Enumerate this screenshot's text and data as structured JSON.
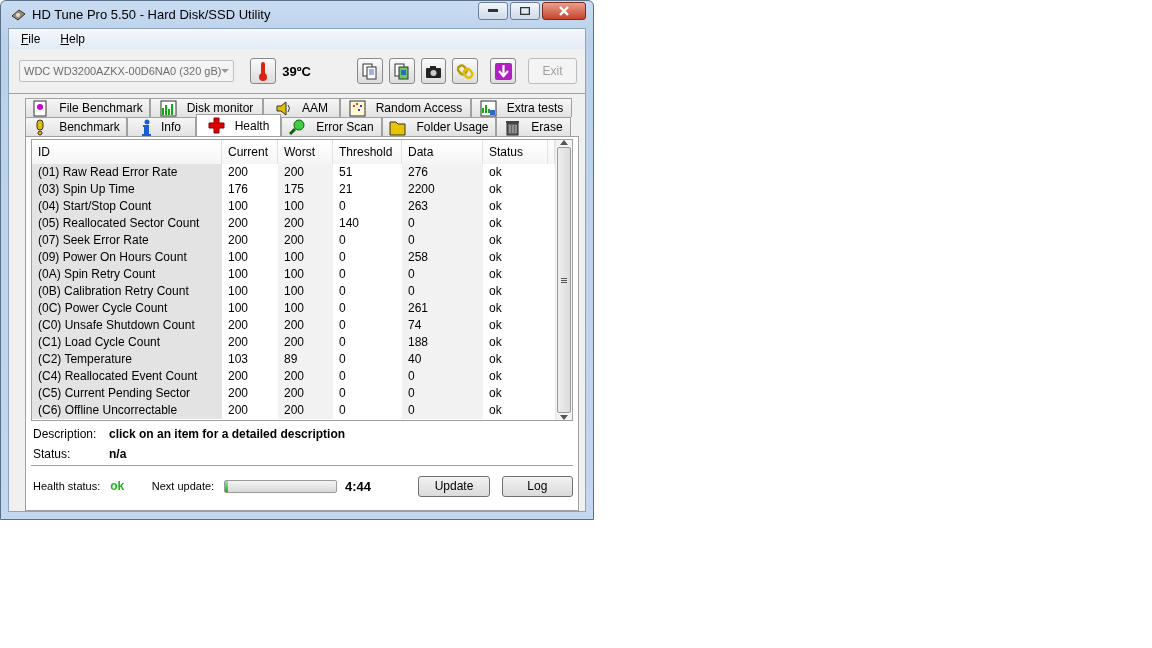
{
  "window": {
    "title": "HD Tune Pro 5.50 - Hard Disk/SSD Utility"
  },
  "menu": [
    "File",
    "Help"
  ],
  "toolbar": {
    "drive": "WDC WD3200AZKX-00D6NA0 (320 gB)",
    "temperature": "39ºC",
    "exit": {
      "label": "Exit",
      "disabled": true
    }
  },
  "tabs": [
    [
      {
        "label": "File Benchmark",
        "selected": false
      },
      {
        "label": "Disk monitor",
        "selected": false
      },
      {
        "label": "AAM",
        "selected": false
      },
      {
        "label": "Random Access",
        "selected": false
      },
      {
        "label": "Extra tests",
        "selected": false
      }
    ],
    [
      {
        "label": "Benchmark",
        "selected": false
      },
      {
        "label": "Info",
        "selected": false
      },
      {
        "label": "Health",
        "selected": true
      },
      {
        "label": "Error Scan",
        "selected": false
      },
      {
        "label": "Folder Usage",
        "selected": false
      },
      {
        "label": "Erase",
        "selected": false
      }
    ]
  ],
  "table": {
    "columns": [
      "ID",
      "Current",
      "Worst",
      "Threshold",
      "Data",
      "Status"
    ],
    "rows": [
      [
        "(01) Raw Read Error Rate",
        "200",
        "200",
        "51",
        "276",
        "ok"
      ],
      [
        "(03) Spin Up Time",
        "176",
        "175",
        "21",
        "2200",
        "ok"
      ],
      [
        "(04) Start/Stop Count",
        "100",
        "100",
        "0",
        "263",
        "ok"
      ],
      [
        "(05) Reallocated Sector Count",
        "200",
        "200",
        "140",
        "0",
        "ok"
      ],
      [
        "(07) Seek Error Rate",
        "200",
        "200",
        "0",
        "0",
        "ok"
      ],
      [
        "(09) Power On Hours Count",
        "100",
        "100",
        "0",
        "258",
        "ok"
      ],
      [
        "(0A) Spin Retry Count",
        "100",
        "100",
        "0",
        "0",
        "ok"
      ],
      [
        "(0B) Calibration Retry Count",
        "100",
        "100",
        "0",
        "0",
        "ok"
      ],
      [
        "(0C) Power Cycle Count",
        "100",
        "100",
        "0",
        "261",
        "ok"
      ],
      [
        "(C0) Unsafe Shutdown Count",
        "200",
        "200",
        "0",
        "74",
        "ok"
      ],
      [
        "(C1) Load Cycle Count",
        "200",
        "200",
        "0",
        "188",
        "ok"
      ],
      [
        "(C2) Temperature",
        "103",
        "89",
        "0",
        "40",
        "ok"
      ],
      [
        "(C4) Reallocated Event Count",
        "200",
        "200",
        "0",
        "0",
        "ok"
      ],
      [
        "(C5) Current Pending Sector",
        "200",
        "200",
        "0",
        "0",
        "ok"
      ],
      [
        "(C6) Offline Uncorrectable",
        "200",
        "200",
        "0",
        "0",
        "ok"
      ]
    ]
  },
  "details": [
    {
      "label": "Description:",
      "value": "click on an item for a detailed description"
    },
    {
      "label": "Status:",
      "value": "n/a"
    }
  ],
  "footer": {
    "health_label": "Health status:",
    "health_value": "ok",
    "next_label": "Next update:",
    "level": 0.03,
    "time": "4:44",
    "buttons": [
      "Update",
      "Log"
    ]
  }
}
